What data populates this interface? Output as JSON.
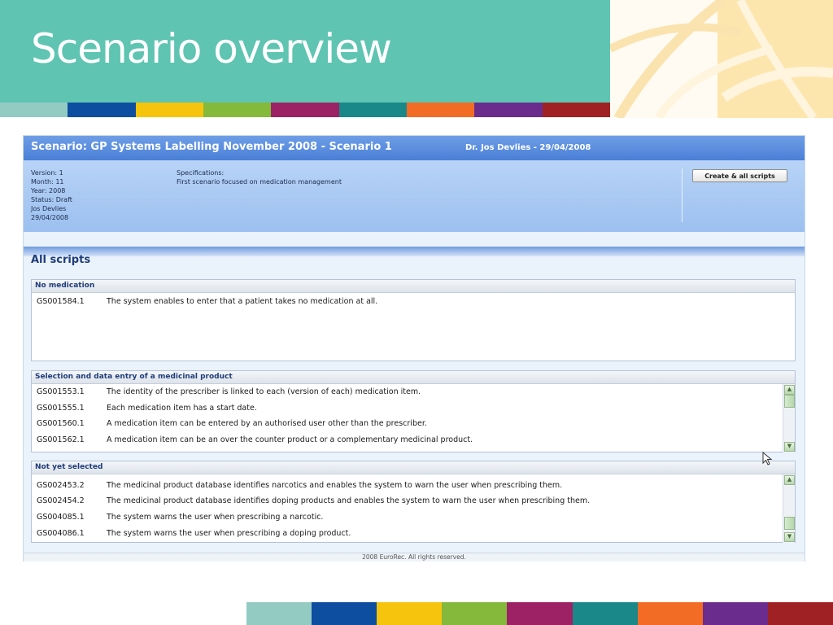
{
  "slide": {
    "title": "Scenario overview",
    "strip_colors": [
      "#93cbc3",
      "#0d4ea0",
      "#f6c40d",
      "#84b93c",
      "#9c2265",
      "#1a8888",
      "#f26c26",
      "#6a2d8e",
      "#a02124"
    ],
    "bottom_strip_colors": [
      "#93cbc3",
      "#0d4ea0",
      "#f6c40d",
      "#84b93c",
      "#9c2265",
      "#1a8888",
      "#f26c26",
      "#6a2d8e",
      "#a02124"
    ]
  },
  "app": {
    "title": "Scenario: GP Systems Labelling November 2008 - Scenario 1",
    "author": "Dr. Jos Devlies - 29/04/2008",
    "info": {
      "version": "Version: 1",
      "month": "Month: 11",
      "year": "Year: 2008",
      "status": "Status: Draft",
      "author": "Jos Devlies",
      "date": "29/04/2008",
      "spec_label": "Specifications:",
      "spec_text": "First scenario focused on medication management"
    },
    "create_button": "Create & all scripts",
    "section_heading": "All scripts",
    "groups": [
      {
        "title": "No medication",
        "rows": [
          {
            "code": "GS001584.1",
            "text": "The system enables to enter that a patient takes no medication at all."
          }
        ]
      },
      {
        "title": "Selection and data entry of a medicinal product",
        "rows": [
          {
            "code": "GS001553.1",
            "text": "The identity of the prescriber is linked to each (version of each) medication item."
          },
          {
            "code": "GS001555.1",
            "text": "Each medication item has a start date."
          },
          {
            "code": "GS001560.1",
            "text": "A medication item can be entered by an authorised user other than the prescriber."
          },
          {
            "code": "GS001562.1",
            "text": "A medication item can be an over the counter product or a complementary medicinal product."
          }
        ]
      },
      {
        "title": "Not yet selected",
        "rows": [
          {
            "code": "GS002453.2",
            "text": "The medicinal product database identifies narcotics and enables the system to warn the user when prescribing them."
          },
          {
            "code": "GS002454.2",
            "text": "The medicinal product database identifies doping products and enables the system to warn the user when prescribing them."
          },
          {
            "code": "GS004085.1",
            "text": "The system warns the user when prescribing a narcotic."
          },
          {
            "code": "GS004086.1",
            "text": "The system warns the user when prescribing a doping product."
          }
        ]
      }
    ],
    "footer": "2008 EuroRec. All rights reserved."
  },
  "icons": {
    "scroll_up": "chevron-up-icon",
    "scroll_down": "chevron-down-icon",
    "cursor": "mouse-pointer-icon"
  }
}
